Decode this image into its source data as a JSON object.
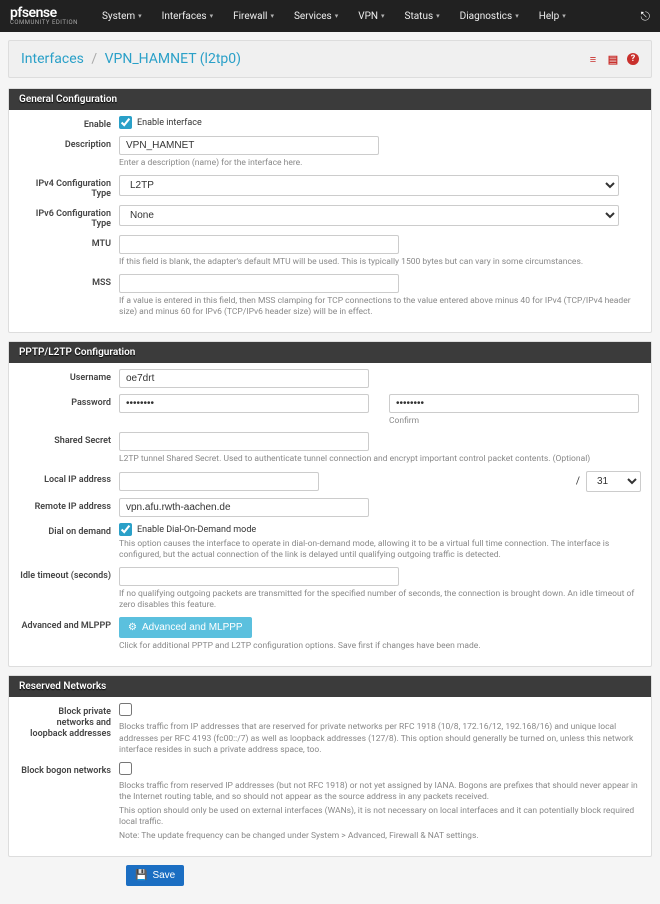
{
  "brand": {
    "main": "pfsense",
    "sub": "COMMUNITY EDITION"
  },
  "nav": {
    "items": [
      "System",
      "Interfaces",
      "Firewall",
      "Services",
      "VPN",
      "Status",
      "Diagnostics",
      "Help"
    ]
  },
  "breadcrumb": {
    "root": "Interfaces",
    "current": "VPN_HAMNET (l2tp0)"
  },
  "general": {
    "title": "General Configuration",
    "enable": {
      "label": "Enable",
      "text": "Enable interface",
      "checked": true
    },
    "description": {
      "label": "Description",
      "value": "VPN_HAMNET",
      "help": "Enter a description (name) for the interface here."
    },
    "ipv4type": {
      "label": "IPv4 Configuration Type",
      "value": "L2TP"
    },
    "ipv6type": {
      "label": "IPv6 Configuration Type",
      "value": "None"
    },
    "mtu": {
      "label": "MTU",
      "value": "",
      "help": "If this field is blank, the adapter's default MTU will be used. This is typically 1500 bytes but can vary in some circumstances."
    },
    "mss": {
      "label": "MSS",
      "value": "",
      "help": "If a value is entered in this field, then MSS clamping for TCP connections to the value entered above minus 40 for IPv4 (TCP/IPv4 header size) and minus 60 for IPv6 (TCP/IPv6 header size) will be in effect."
    }
  },
  "pptp": {
    "title": "PPTP/L2TP Configuration",
    "username": {
      "label": "Username",
      "value": "oe7drt"
    },
    "password": {
      "label": "Password",
      "value": "••••••••",
      "confirm": "••••••••",
      "confirm_label": "Confirm"
    },
    "secret": {
      "label": "Shared Secret",
      "value": "",
      "help": "L2TP tunnel Shared Secret. Used to authenticate tunnel connection and encrypt important control packet contents. (Optional)"
    },
    "localip": {
      "label": "Local IP address",
      "value": "",
      "netmask": "31",
      "slash": "/"
    },
    "remoteip": {
      "label": "Remote IP address",
      "value": "vpn.afu.rwth-aachen.de"
    },
    "dod": {
      "label": "Dial on demand",
      "text": "Enable Dial-On-Demand mode",
      "checked": true,
      "help": "This option causes the interface to operate in dial-on-demand mode, allowing it to be a virtual full time connection. The interface is configured, but the actual connection of the link is delayed until qualifying outgoing traffic is detected."
    },
    "idle": {
      "label": "Idle timeout (seconds)",
      "value": "",
      "help": "If no qualifying outgoing packets are transmitted for the specified number of seconds, the connection is brought down. An idle timeout of zero disables this feature."
    },
    "adv": {
      "label": "Advanced and MLPPP",
      "btn": "Advanced and MLPPP",
      "help": "Click for additional PPTP and L2TP configuration options. Save first if changes have been made."
    }
  },
  "reserved": {
    "title": "Reserved Networks",
    "priv": {
      "label": "Block private networks and loopback addresses",
      "checked": false,
      "help": "Blocks traffic from IP addresses that are reserved for private networks per RFC 1918 (10/8, 172.16/12, 192.168/16) and unique local addresses per RFC 4193 (fc00::/7) as well as loopback addresses (127/8). This option should generally be turned on, unless this network interface resides in such a private address space, too."
    },
    "bogon": {
      "label": "Block bogon networks",
      "checked": false,
      "help1": "Blocks traffic from reserved IP addresses (but not RFC 1918) or not yet assigned by IANA. Bogons are prefixes that should never appear in the Internet routing table, and so should not appear as the source address in any packets received.",
      "help2": "This option should only be used on external interfaces (WANs), it is not necessary on local interfaces and it can potentially block required local traffic.",
      "help3": "Note: The update frequency can be changed under System > Advanced, Firewall & NAT settings."
    }
  },
  "save_label": "Save"
}
